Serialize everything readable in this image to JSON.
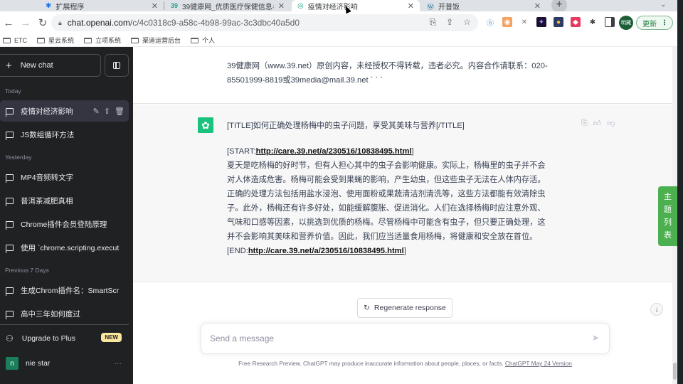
{
  "browser": {
    "tabs": [
      {
        "label": "扩展程序",
        "icon": "puzzle-icon",
        "active": false
      },
      {
        "label": "39健康网_优质医疗保健信息与",
        "icon": "39-logo-icon",
        "active": false
      },
      {
        "label": "疫情对经济影响",
        "icon": "openai-icon",
        "active": true
      },
      {
        "label": "开普饭",
        "icon": "wordpress-icon",
        "active": false
      }
    ],
    "url_host": "chat.openai.com",
    "url_path": "/c/4c0318c9-a58c-4b98-99ac-3c3dbc40a5d0",
    "bookmarks": [
      "ETC",
      "星云系统",
      "立项系统",
      "渠道运营后台",
      "个人"
    ],
    "profile_label": "明藏",
    "update_label": "更新"
  },
  "sidebar": {
    "new_chat_label": "New chat",
    "sections": [
      {
        "title": "Today",
        "items": [
          "疫情对经济影响",
          "JS数组循环方法"
        ]
      },
      {
        "title": "Yesterday",
        "items": [
          "MP4音频转文字",
          "普洱茶减肥真相",
          "Chrome插件会员登陆原理",
          "使用 `chrome.scripting.execut"
        ]
      },
      {
        "title": "Previous 7 Days",
        "items": [
          "生成Chrom插件名：SmartScr",
          "高中三年如何度过"
        ]
      }
    ],
    "upgrade_label": "Upgrade to Plus",
    "new_badge": "NEW",
    "user_initial": "n",
    "user_name": "nie star"
  },
  "conversation": {
    "user_message": {
      "line1": "39健康网（www.39.net）原创内容，未经授权不得转载，违者必究。内容合作请联系：020-",
      "line2": "85501999-8819或39media@mail.39.net ` ` `"
    },
    "assistant_message": {
      "title_line": "[TITLE]如何正确处理杨梅中的虫子问题，享受其美味与营养[/TITLE]",
      "start_prefix": "[START:",
      "start_link": "http://care.39.net/a/230516/10838495.html",
      "start_suffix": "]",
      "body_lines": [
        "夏天是吃杨梅的好时节，但有人担心其中的虫子会影响健康。实际上，杨梅里的虫子并不会",
        "对人体造成危害。杨梅可能会受到果蝇的影响，产生幼虫，但这些虫子无法在人体内存活。",
        "正确的处理方法包括用盐水浸泡、使用面粉或果蔬清洁剂清洗等，这些方法都能有效清除虫",
        "子。此外，杨梅还有许多好处，如能缓解腹胀、促进消化。人们在选择杨梅时应注意外观、",
        "气味和口感等因素，以挑选到优质的杨梅。尽管杨梅中可能含有虫子，但只要正确处理，这",
        "并不会影响其美味和营养价值。因此，我们应当适量食用杨梅，将健康和安全放在首位。"
      ],
      "end_prefix": "[END:",
      "end_link": "http://care.39.net/a/230516/10838495.html",
      "end_suffix": "]"
    },
    "regenerate_label": "Regenerate response",
    "input_placeholder": "Send a message",
    "footer_text": "Free Research Preview. ChatGPT may produce inaccurate information about people, places, or facts. ",
    "footer_link": "ChatGPT May 24 Version"
  },
  "side_tab_chars": [
    "主",
    "题",
    "列",
    "表"
  ],
  "colors": {
    "sidebar_bg": "#202123",
    "accent_green": "#19c37d",
    "side_tab_green": "#4caf50"
  }
}
